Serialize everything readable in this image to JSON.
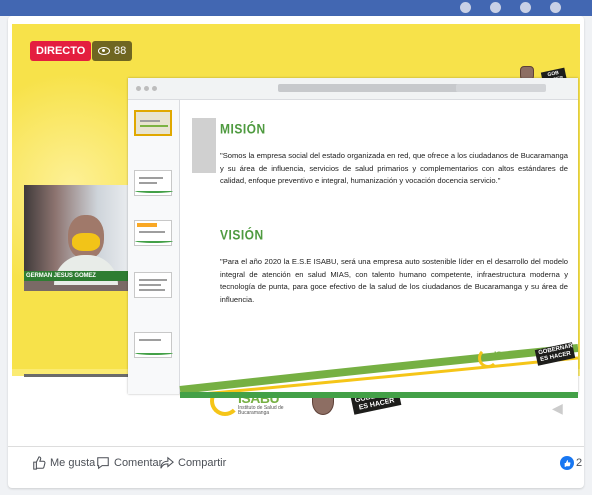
{
  "live": {
    "badge": "DIRECTO",
    "viewers": "88"
  },
  "webcam": {
    "name": "GERMAN JESUS GOMEZ"
  },
  "slide": {
    "mision_title": "MISIÓN",
    "mision_text": "\"Somos la empresa social del estado organizada en red, que ofrece a los ciudadanos de Bucaramanga y su área de influencia, servicios de salud primarios y complementarios con altos estándares de calidad, enfoque preventivo e integral, humanización y vocación docencia servicio.\"",
    "vision_title": "VISIÓN",
    "vision_text": "\"Para el año 2020 la E.S.E ISABU, será una empresa auto sostenible líder en el desarrollo del modelo integral de atención en salud MIAS, con talento humano competente, infraestructura moderna y tecnología de punta, para goce efectivo de la salud de los ciudadanos de Bucaramanga y su área de influencia."
  },
  "logos": {
    "isabu": "ISABU",
    "isabu_sub": "Instituto de Salud de Bucaramanga",
    "hacer": "GOBERNAR ES HACER"
  },
  "actions": {
    "like": "Me gusta",
    "comment": "Comentar",
    "share": "Compartir",
    "reaction_count": "2"
  },
  "colors": {
    "live_red": "#e41e3f",
    "isabu_green": "#76b043",
    "isabu_yellow": "#f5c518",
    "facebook_blue": "#1877f2"
  }
}
